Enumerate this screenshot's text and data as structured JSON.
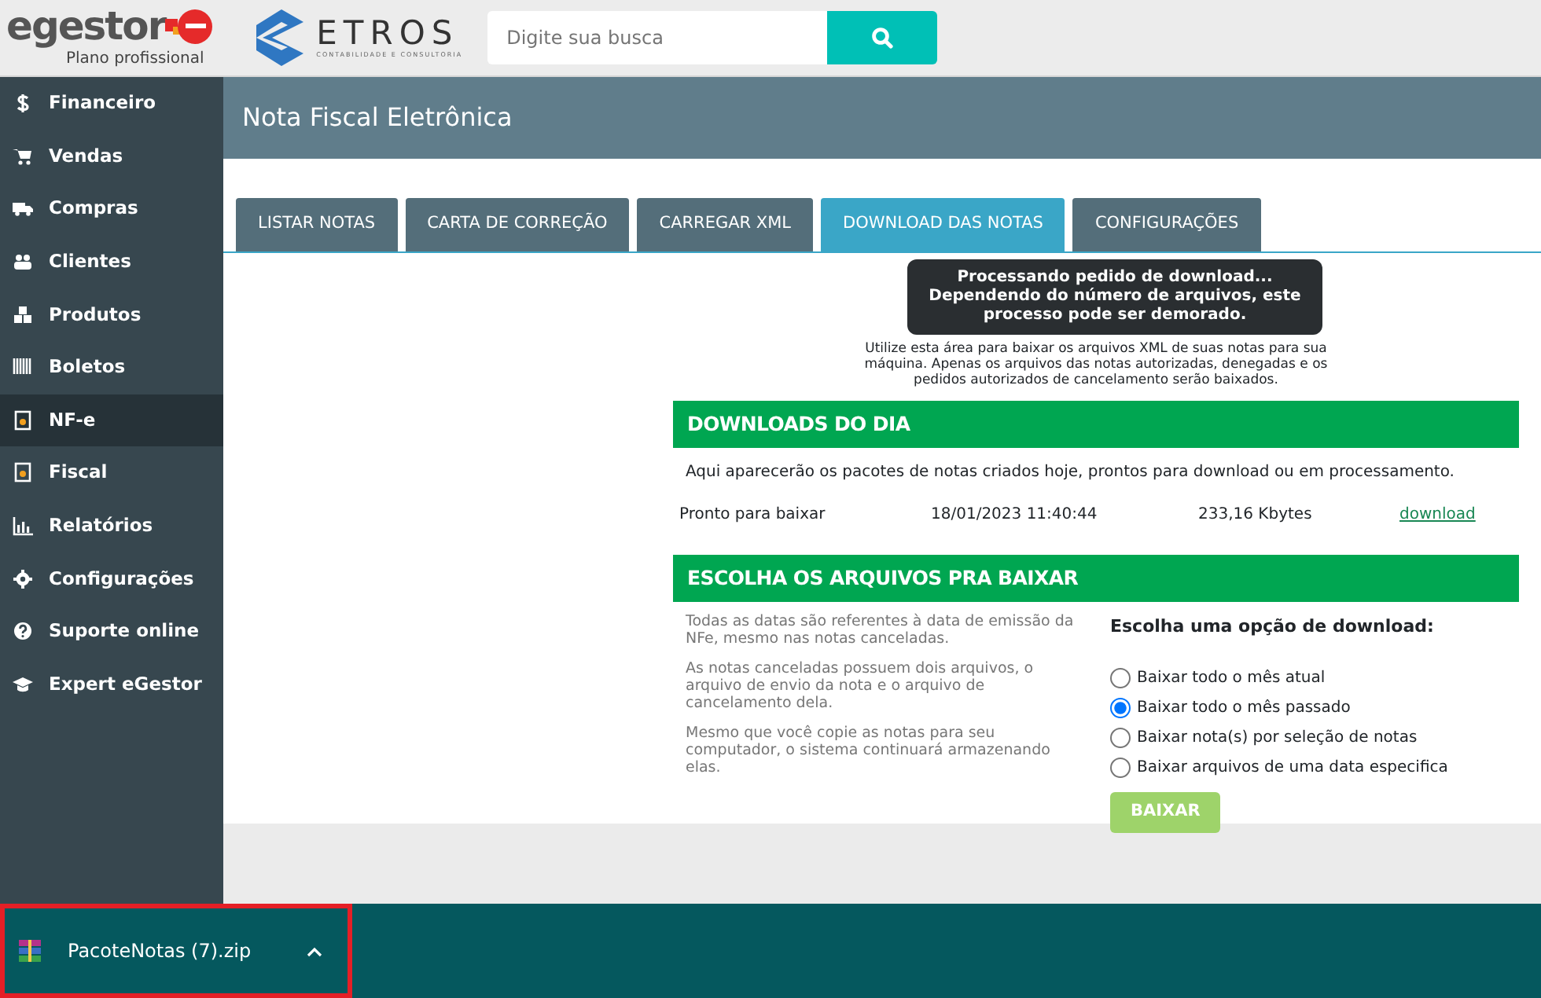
{
  "header": {
    "brand": "egestor",
    "plan": "Plano profissional",
    "partner_logo": "ETROS",
    "partner_tagline": "CONTABILIDADE E CONSULTORIA",
    "search": {
      "placeholder": "Digite sua busca"
    }
  },
  "sidebar": {
    "items": [
      {
        "label": "Financeiro",
        "selected": false
      },
      {
        "label": "Vendas",
        "selected": false
      },
      {
        "label": "Compras",
        "selected": false
      },
      {
        "label": "Clientes",
        "selected": false
      },
      {
        "label": "Produtos",
        "selected": false
      },
      {
        "label": "Boletos",
        "selected": false
      },
      {
        "label": "NF-e",
        "selected": true
      },
      {
        "label": "Fiscal",
        "selected": false
      },
      {
        "label": "Relatórios",
        "selected": false
      },
      {
        "label": "Configurações",
        "selected": false
      },
      {
        "label": "Suporte online",
        "selected": false
      },
      {
        "label": "Expert eGestor",
        "selected": false
      }
    ]
  },
  "page_title": "Nota Fiscal Eletrônica",
  "tabs": [
    {
      "label": "LISTAR NOTAS",
      "selected": false
    },
    {
      "label": "CARTA DE CORREÇÃO",
      "selected": false
    },
    {
      "label": "CARREGAR XML",
      "selected": false
    },
    {
      "label": "DOWNLOAD DAS NOTAS",
      "selected": true
    },
    {
      "label": "CONFIGURAÇÕES",
      "selected": false
    }
  ],
  "tooltip": {
    "title": "Processando pedido de download...",
    "text": "Dependendo do número de arquivos, este processo pode ser demorado."
  },
  "intro": "Utilize esta área para baixar os arquivos XML de suas notas para sua máquina. Apenas os arquivos das notas autorizadas, denegadas e os pedidos autorizados de cancelamento serão baixados.",
  "downloads": {
    "title": "DOWNLOADS DO DIA",
    "note": "Aqui aparecerão os pacotes de notas criados hoje, prontos para download ou em processamento.",
    "rows": [
      {
        "status": "Pronto para baixar",
        "date": "18/01/2023 11:40:44",
        "size": "233,16 Kbytes",
        "link": "download"
      }
    ]
  },
  "choose": {
    "title": "ESCOLHA OS ARQUIVOS PRA BAIXAR",
    "notes": [
      "Todas as datas são referentes à data de emissão da NFe, mesmo nas notas canceladas.",
      "As notas canceladas possuem dois arquivos, o arquivo de envio da nota e o arquivo de cancelamento dela.",
      "Mesmo que você copie as notas para seu computador, o sistema continuará armazenando elas."
    ],
    "options_title": "Escolha uma opção de download:",
    "options": [
      {
        "label": "Baixar todo o mês atual",
        "selected": false
      },
      {
        "label": "Baixar todo o mês passado",
        "selected": true
      },
      {
        "label": "Baixar nota(s) por seleção de notas",
        "selected": false
      },
      {
        "label": "Baixar arquivos de uma data especifica",
        "selected": false
      }
    ],
    "button": {
      "label": "BAIXAR",
      "disabled": true
    }
  },
  "download_bar": {
    "file": "PacoteNotas (7).zip"
  }
}
